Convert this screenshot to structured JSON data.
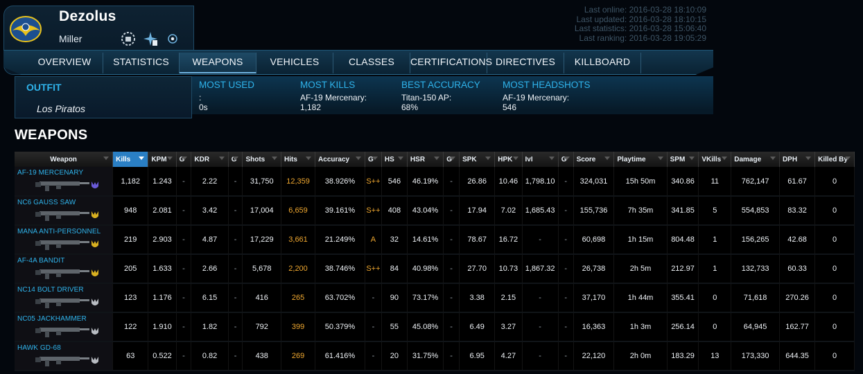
{
  "player": {
    "name": "Dezolus",
    "server": "Miller",
    "faction_icon": "new-conglomerate-emblem-icon",
    "badges": [
      "gear-badge-icon",
      "medic-badge-icon",
      "target-badge-icon"
    ]
  },
  "last_info": {
    "online": "Last online: 2016-03-28 18:10:09",
    "updated": "Last updated: 2016-03-28 18:10:15",
    "statistics": "Last statistics: 2016-03-28 15:06:40",
    "ranking": "Last ranking: 2016-03-28 19:05:29"
  },
  "nav": {
    "tabs": [
      {
        "label": "OVERVIEW"
      },
      {
        "label": "STATISTICS"
      },
      {
        "label": "WEAPONS"
      },
      {
        "label": "VEHICLES"
      },
      {
        "label": "CLASSES"
      },
      {
        "label": "CERTIFICATIONS"
      },
      {
        "label": "DIRECTIVES"
      },
      {
        "label": "KILLBOARD"
      }
    ],
    "active": "WEAPONS"
  },
  "outfit": {
    "label": "OUTFIT",
    "name": "Los Piratos"
  },
  "summary": {
    "most_used": {
      "label": "MOST USED",
      "line1": ":",
      "line2": "0s"
    },
    "most_kills": {
      "label": "MOST KILLS",
      "line1": "AF-19 Mercenary:",
      "line2": "1,182"
    },
    "best_accuracy": {
      "label": "BEST ACCURACY",
      "line1": "Titan-150 AP:",
      "line2": "68%"
    },
    "most_headshots": {
      "label": "MOST HEADSHOTS",
      "line1": "AF-19 Mercenary:",
      "line2": "546"
    }
  },
  "section_title": "WEAPONS",
  "table": {
    "columns": [
      "Weapon",
      "Kills",
      "KPM",
      "G",
      "KDR",
      "G",
      "Shots",
      "Hits",
      "Accuracy",
      "G",
      "HS",
      "HSR",
      "G",
      "SPK",
      "HPK",
      "IvI",
      "G",
      "Score",
      "Playtime",
      "SPM",
      "VKills",
      "Damage",
      "DPH",
      "Killed By"
    ],
    "sorted_column": "Kills",
    "colors": {
      "medal_purple": "#6a5ad8",
      "medal_gold": "#d8b020",
      "medal_silver": "#b8bcc2",
      "grade_orange": "#f0a830"
    },
    "rows": [
      {
        "weapon": "AF-19 MERCENARY",
        "medal": "purple",
        "cells": [
          "1,182",
          "1.243",
          "-",
          "2.22",
          "-",
          "31,750",
          "12,359",
          "38.926%",
          "S++",
          "546",
          "46.19%",
          "-",
          "26.86",
          "10.46",
          "1,798.10",
          "-",
          "324,031",
          "15h 50m",
          "340.86",
          "11",
          "762,147",
          "61.67",
          "0"
        ]
      },
      {
        "weapon": "NC6 GAUSS SAW",
        "medal": "gold",
        "cells": [
          "948",
          "2.081",
          "-",
          "3.42",
          "-",
          "17,004",
          "6,659",
          "39.161%",
          "S++",
          "408",
          "43.04%",
          "-",
          "17.94",
          "7.02",
          "1,685.43",
          "-",
          "155,736",
          "7h 35m",
          "341.85",
          "5",
          "554,853",
          "83.32",
          "0"
        ]
      },
      {
        "weapon": "MANA ANTI-PERSONNEL",
        "medal": "gold",
        "cells": [
          "219",
          "2.903",
          "-",
          "4.87",
          "-",
          "17,229",
          "3,661",
          "21.249%",
          "A",
          "32",
          "14.61%",
          "-",
          "78.67",
          "16.72",
          "-",
          "-",
          "60,698",
          "1h 15m",
          "804.48",
          "1",
          "156,265",
          "42.68",
          "0"
        ]
      },
      {
        "weapon": "AF-4A BANDIT",
        "medal": "gold",
        "cells": [
          "205",
          "1.633",
          "-",
          "2.66",
          "-",
          "5,678",
          "2,200",
          "38.746%",
          "S++",
          "84",
          "40.98%",
          "-",
          "27.70",
          "10.73",
          "1,867.32",
          "-",
          "26,738",
          "2h 5m",
          "212.97",
          "1",
          "132,733",
          "60.33",
          "0"
        ]
      },
      {
        "weapon": "NC14 BOLT DRIVER",
        "medal": "silver",
        "cells": [
          "123",
          "1.176",
          "-",
          "6.15",
          "-",
          "416",
          "265",
          "63.702%",
          "-",
          "90",
          "73.17%",
          "-",
          "3.38",
          "2.15",
          "-",
          "-",
          "37,170",
          "1h 44m",
          "355.41",
          "0",
          "71,618",
          "270.26",
          "0"
        ]
      },
      {
        "weapon": "NC05 JACKHAMMER",
        "medal": "silver",
        "cells": [
          "122",
          "1.910",
          "-",
          "1.82",
          "-",
          "792",
          "399",
          "50.379%",
          "-",
          "55",
          "45.08%",
          "-",
          "6.49",
          "3.27",
          "-",
          "-",
          "16,363",
          "1h 3m",
          "256.14",
          "0",
          "64,945",
          "162.77",
          "0"
        ]
      },
      {
        "weapon": "HAWK GD-68",
        "medal": "silver",
        "cells": [
          "63",
          "0.522",
          "-",
          "0.82",
          "-",
          "438",
          "269",
          "61.416%",
          "-",
          "20",
          "31.75%",
          "-",
          "6.95",
          "4.27",
          "-",
          "-",
          "22,120",
          "2h 0m",
          "183.29",
          "13",
          "173,330",
          "644.35",
          "0"
        ]
      }
    ]
  }
}
